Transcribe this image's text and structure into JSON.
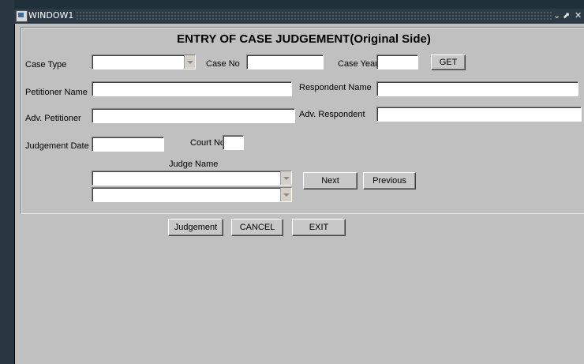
{
  "window": {
    "title": "WINDOW1"
  },
  "form": {
    "title": "ENTRY OF CASE JUDGEMENT(Original Side)",
    "case_type_label": "Case Type",
    "case_no_label": "Case No",
    "case_year_label": "Case Year",
    "get_button": "GET",
    "petitioner_name_label": "Petitioner Name",
    "respondent_name_label": "Respondent Name",
    "adv_petitioner_label": "Adv. Petitioner",
    "adv_respondent_label": "Adv. Respondent",
    "judgement_date_label": "Judgement Date",
    "court_no_label": "Court No",
    "judge_name_label": "Judge Name",
    "next_button": "Next",
    "previous_button": "Previous"
  },
  "actions": {
    "judgement_button": "Judgement",
    "cancel_button": "CANCEL",
    "exit_button": "EXIT"
  },
  "fields": {
    "case_type": "",
    "case_no": "",
    "case_year": "",
    "petitioner_name": "",
    "respondent_name": "",
    "adv_petitioner": "",
    "adv_respondent": "",
    "judgement_date": "",
    "court_no": "",
    "judge_name_1": "",
    "judge_name_2": ""
  }
}
